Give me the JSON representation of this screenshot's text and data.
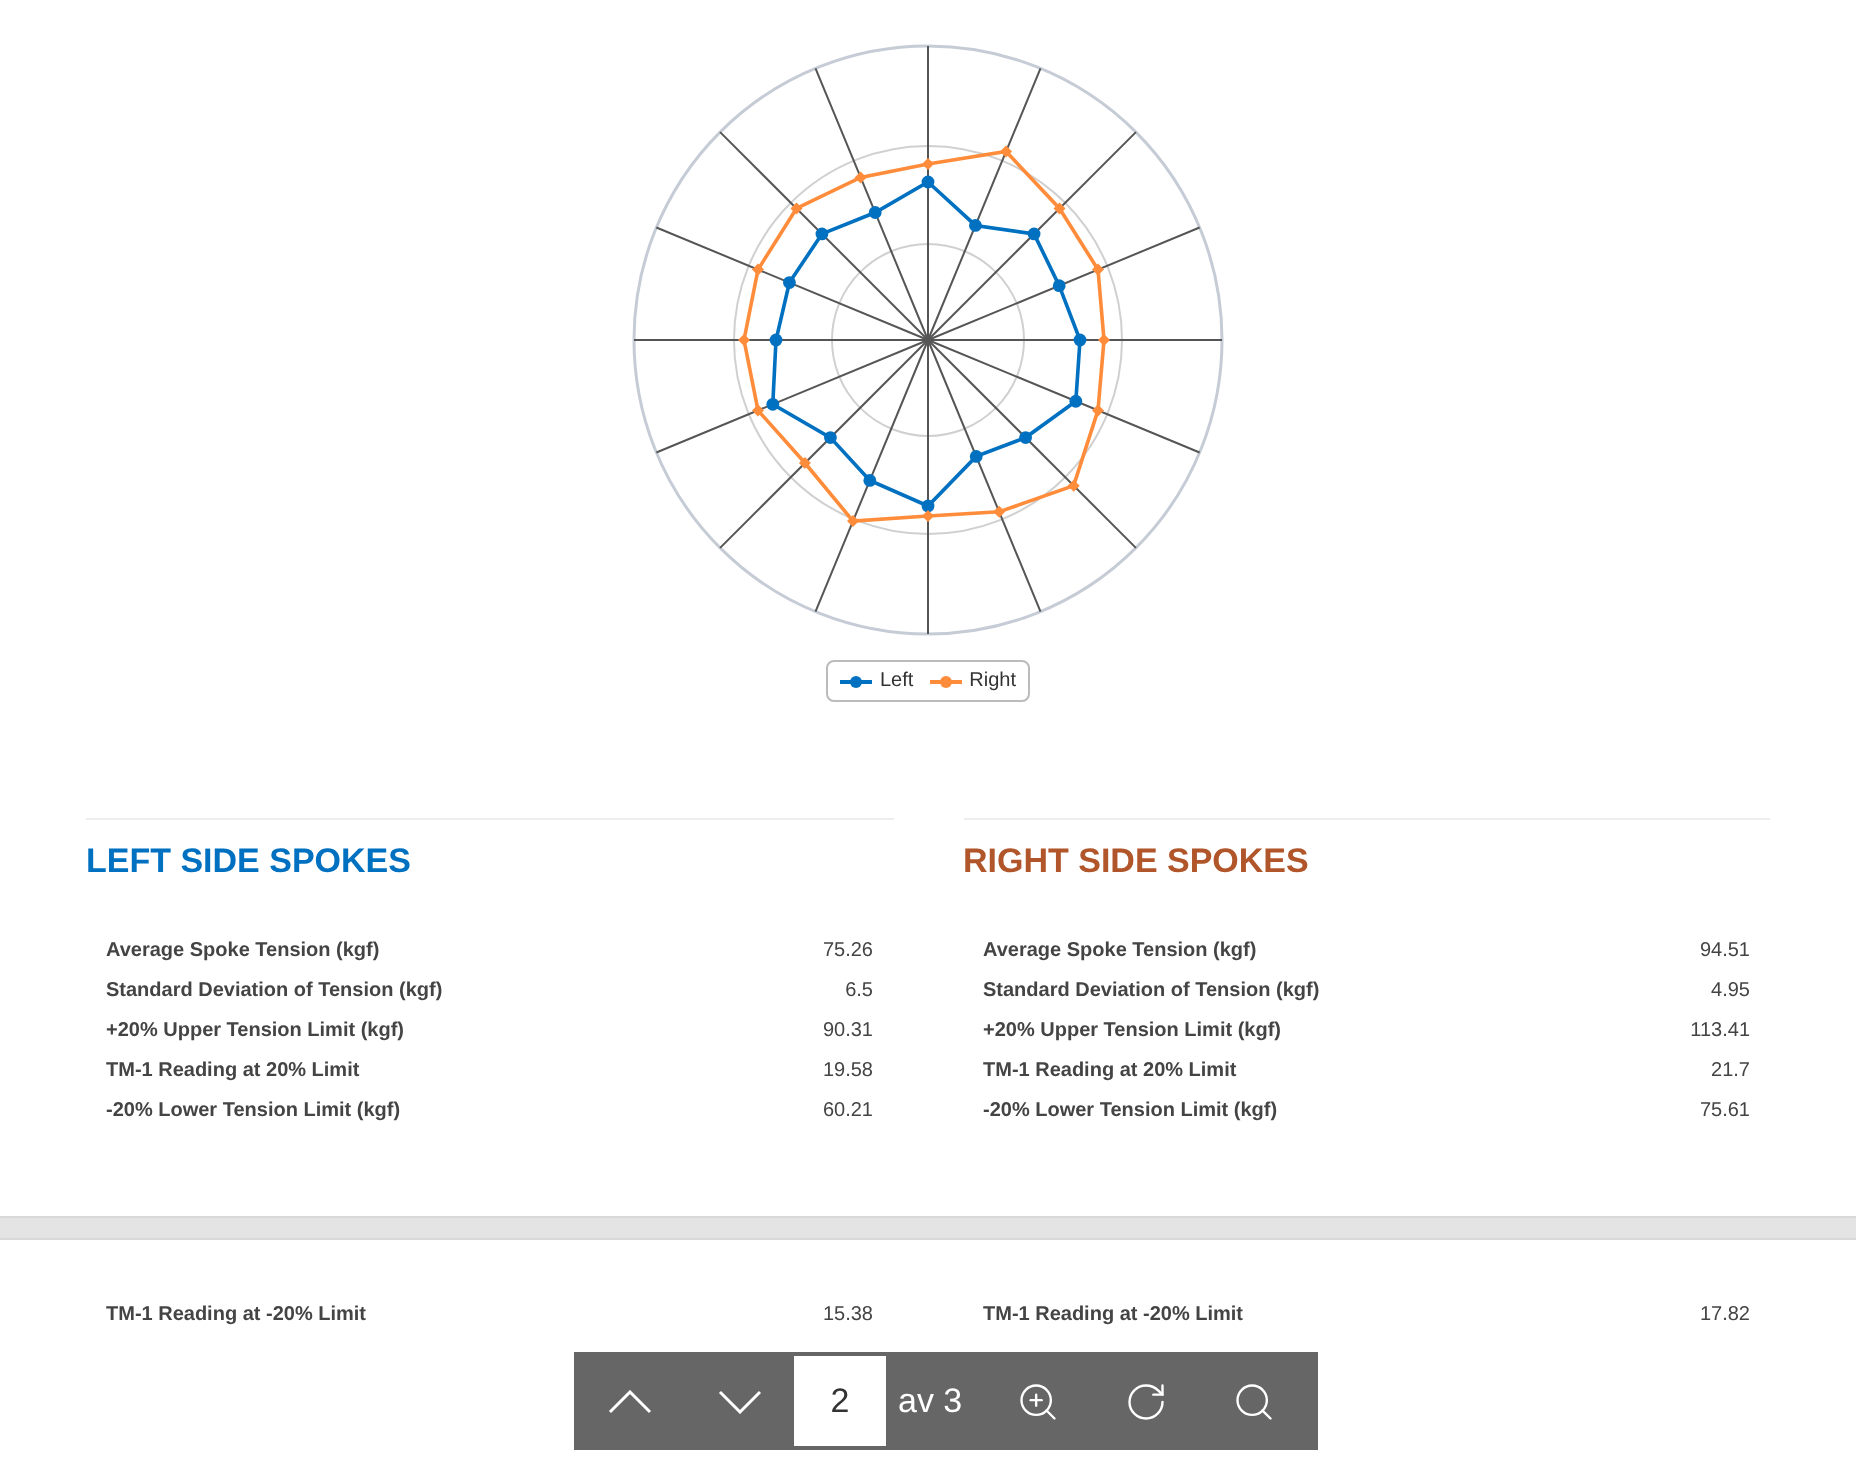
{
  "chart": {
    "legend": [
      {
        "name": "Left",
        "color": "#0070c0"
      },
      {
        "name": "Right",
        "color": "#ff8c3a"
      }
    ]
  },
  "sections": [
    {
      "title": "LEFT SIDE SPOKES",
      "color": "#0070c0",
      "rows": [
        {
          "label": "Average Spoke Tension (kgf)",
          "value": "75.26"
        },
        {
          "label": "Standard Deviation of Tension (kgf)",
          "value": "6.5"
        },
        {
          "label": "+20% Upper Tension Limit (kgf)",
          "value": "90.31"
        },
        {
          "label": "TM-1 Reading at 20% Limit",
          "value": "19.58"
        },
        {
          "label": "-20% Lower Tension Limit (kgf)",
          "value": "60.21"
        }
      ]
    },
    {
      "title": "RIGHT SIDE SPOKES",
      "color": "#b0562a",
      "rows": [
        {
          "label": "Average Spoke Tension (kgf)",
          "value": "94.51"
        },
        {
          "label": "Standard Deviation of Tension (kgf)",
          "value": "4.95"
        },
        {
          "label": "+20% Upper Tension Limit (kgf)",
          "value": "113.41"
        },
        {
          "label": "TM-1 Reading at 20% Limit",
          "value": "21.7"
        },
        {
          "label": "-20% Lower Tension Limit (kgf)",
          "value": "75.61"
        }
      ]
    }
  ],
  "next_page_rows": [
    {
      "label": "TM-1 Reading at -20% Limit",
      "value": "15.38"
    },
    {
      "label": "TM-1 Reading at -20% Limit",
      "value": "17.82"
    }
  ],
  "toolbar": {
    "page": "2",
    "total": "av 3"
  }
}
